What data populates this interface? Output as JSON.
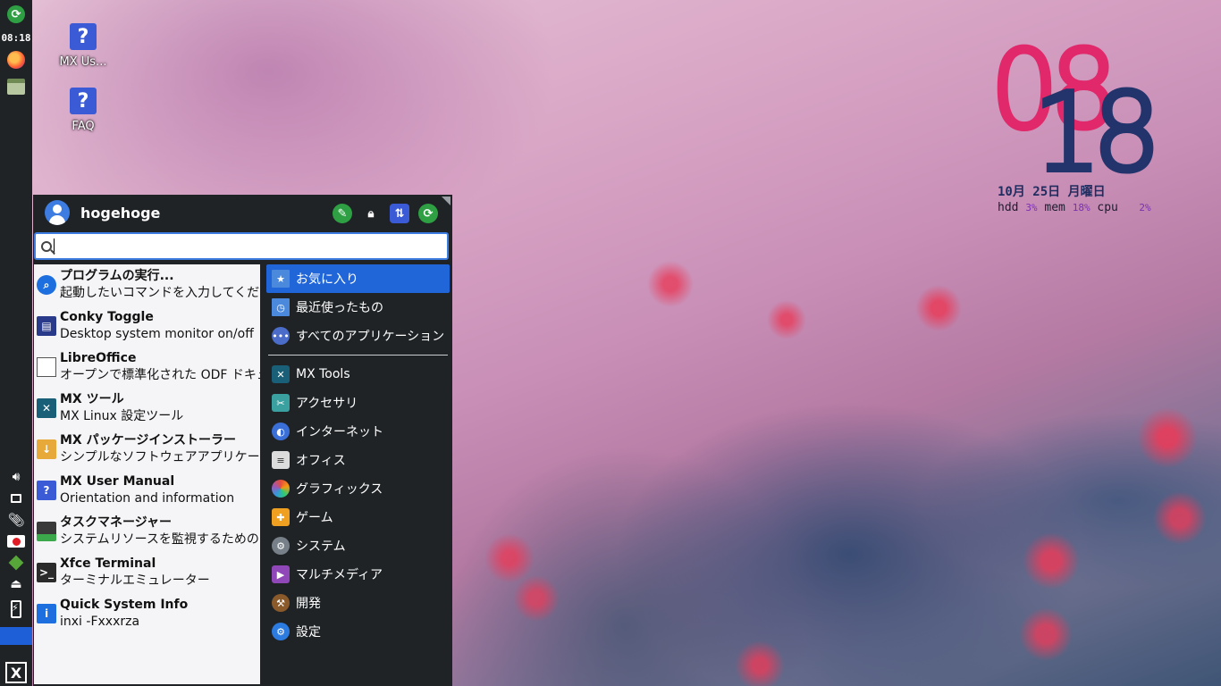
{
  "panel": {
    "time": "08:18",
    "top_icons": [
      "update-icon",
      "firefox-icon",
      "file-manager-icon"
    ],
    "bottom_icons": [
      "volume-icon",
      "display-icon",
      "clipboard-icon",
      "screen-recorder-icon",
      "package-icon",
      "eject-icon",
      "battery-icon"
    ],
    "menu_button_label": "X"
  },
  "desktop": {
    "icons": [
      {
        "label": "MX Us...",
        "icon": "help-icon"
      },
      {
        "label": "FAQ",
        "icon": "help-icon"
      }
    ]
  },
  "conky": {
    "hours": "08",
    "minutes": "18",
    "date": "10月 25日 月曜日",
    "hdd_label": "hdd",
    "hdd_value": "3%",
    "mem_label": "mem",
    "mem_value": "18%",
    "cpu_label": "cpu",
    "cpu_value": "2%",
    "colors": {
      "hours": "#e0286a",
      "minutes": "#22346b"
    }
  },
  "menu": {
    "username": "hogehoge",
    "header_actions": [
      "settings-icon",
      "lock-icon",
      "switch-user-icon",
      "logout-icon"
    ],
    "search": {
      "value": "",
      "placeholder": ""
    },
    "favorites": [
      {
        "title": "プログラムの実行...",
        "desc": "起動したいコマンドを入力してください",
        "icon": "run-icon"
      },
      {
        "title": "Conky Toggle",
        "desc": "Desktop system monitor on/off",
        "icon": "conky-icon"
      },
      {
        "title": "LibreOffice",
        "desc": "オープンで標準化された ODF ドキュメント",
        "icon": "libreoffice-icon"
      },
      {
        "title": "MX ツール",
        "desc": "MX Linux 設定ツール",
        "icon": "mx-tools-icon"
      },
      {
        "title": "MX パッケージインストーラー",
        "desc": "シンプルなソフトウェアアプリケーション",
        "icon": "package-installer-icon"
      },
      {
        "title": "MX User Manual",
        "desc": "Orientation and information",
        "icon": "manual-icon"
      },
      {
        "title": "タスクマネージャー",
        "desc": "システムリソースを監視するためのツール",
        "icon": "task-manager-icon"
      },
      {
        "title": "Xfce Terminal",
        "desc": "ターミナルエミュレーター",
        "icon": "terminal-icon"
      },
      {
        "title": "Quick System Info",
        "desc": "inxi -Fxxxrza",
        "icon": "system-info-icon"
      }
    ],
    "categories_top": [
      {
        "label": "お気に入り",
        "icon": "favorites-folder-icon",
        "active": true
      },
      {
        "label": "最近使ったもの",
        "icon": "recent-folder-icon",
        "active": false
      },
      {
        "label": "すべてのアプリケーション",
        "icon": "all-apps-icon",
        "active": false
      }
    ],
    "categories": [
      {
        "label": "MX Tools",
        "icon": "mx-tools-icon"
      },
      {
        "label": "アクセサリ",
        "icon": "accessories-icon"
      },
      {
        "label": "インターネット",
        "icon": "internet-icon"
      },
      {
        "label": "オフィス",
        "icon": "office-icon"
      },
      {
        "label": "グラフィックス",
        "icon": "graphics-icon"
      },
      {
        "label": "ゲーム",
        "icon": "games-icon"
      },
      {
        "label": "システム",
        "icon": "system-icon"
      },
      {
        "label": "マルチメディア",
        "icon": "multimedia-icon"
      },
      {
        "label": "開発",
        "icon": "development-icon"
      },
      {
        "label": "設定",
        "icon": "settings-icon"
      }
    ],
    "colors": {
      "accent": "#2166d8",
      "panel_bg": "#1f2326"
    }
  }
}
